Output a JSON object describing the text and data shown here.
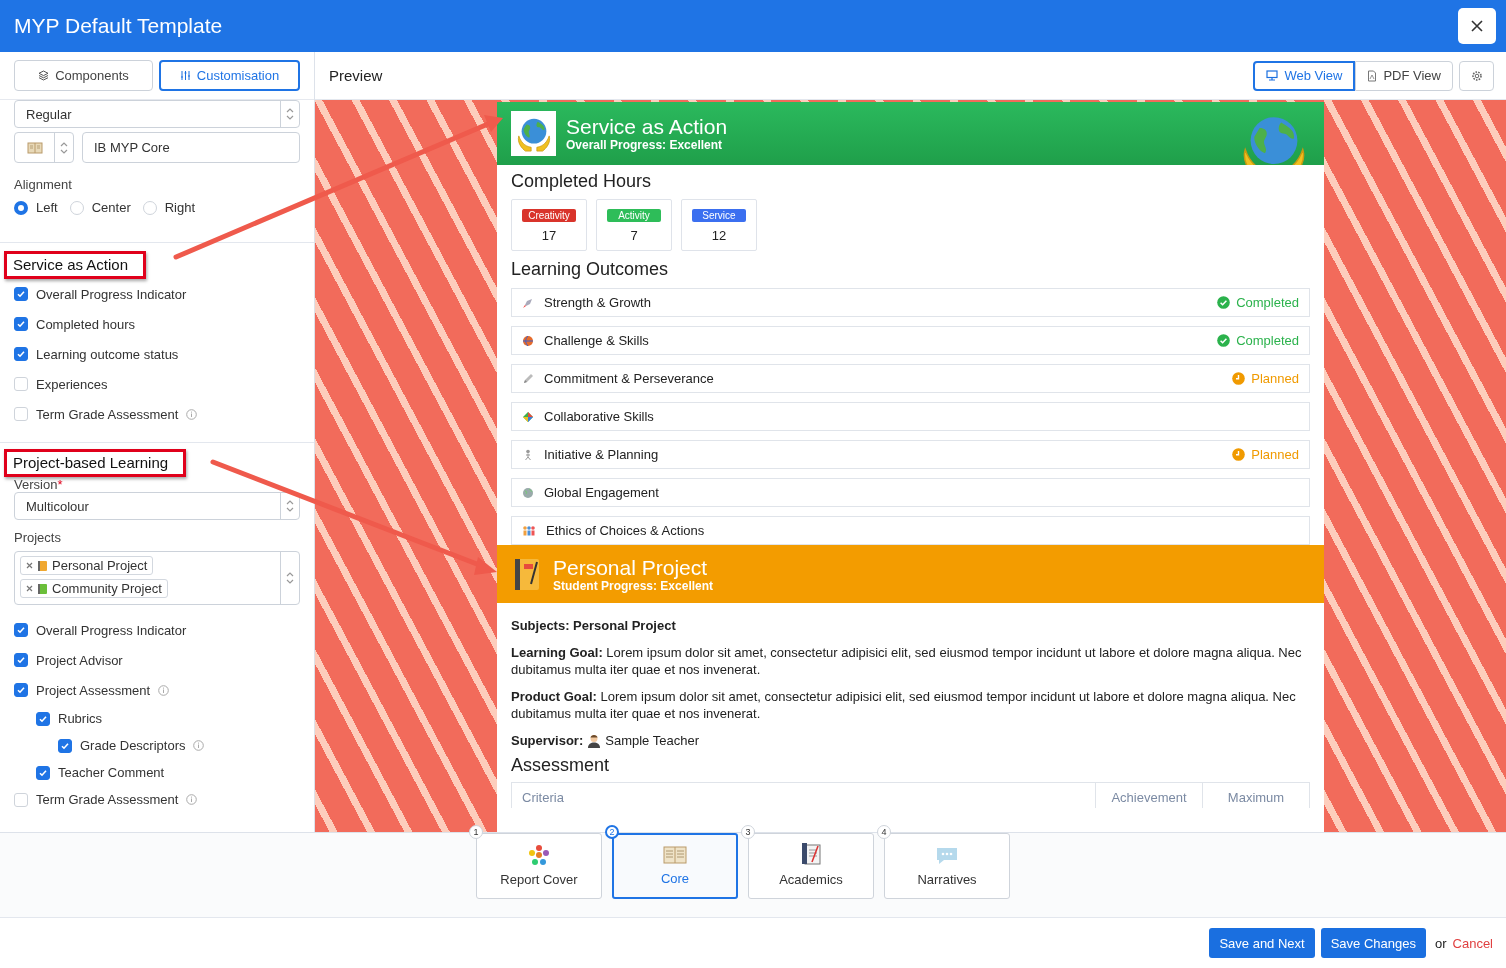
{
  "window": {
    "title": "MYP Default Template"
  },
  "sidebar": {
    "tabs": [
      {
        "label": "Components",
        "selected": false
      },
      {
        "label": "Customisation",
        "selected": true
      }
    ],
    "style_select": {
      "value": "Regular"
    },
    "title_field": {
      "value": "IB MYP Core"
    },
    "alignment": {
      "label": "Alignment",
      "options": [
        {
          "label": "Left",
          "selected": true
        },
        {
          "label": "Center",
          "selected": false
        },
        {
          "label": "Right",
          "selected": false
        }
      ]
    },
    "sections": [
      {
        "title": "Service as Action",
        "options": [
          {
            "label": "Overall Progress Indicator",
            "checked": true,
            "info": false
          },
          {
            "label": "Completed hours",
            "checked": true,
            "info": false
          },
          {
            "label": "Learning outcome status",
            "checked": true,
            "info": false
          },
          {
            "label": "Experiences",
            "checked": false,
            "info": false
          },
          {
            "label": "Term Grade Assessment",
            "checked": false,
            "info": true
          }
        ]
      },
      {
        "title": "Project-based Learning",
        "version": {
          "label": "Version",
          "required_mark": "*",
          "value": "Multicolour"
        },
        "projects": {
          "label": "Projects",
          "tags": [
            "Personal Project",
            "Community Project"
          ]
        },
        "options": [
          {
            "label": "Overall Progress Indicator",
            "checked": true,
            "info": false
          },
          {
            "label": "Project Advisor",
            "checked": true,
            "info": false
          },
          {
            "label": "Project Assessment",
            "checked": true,
            "info": true,
            "children": [
              {
                "label": "Rubrics",
                "checked": true,
                "info": false,
                "children": [
                  {
                    "label": "Grade Descriptors",
                    "checked": true,
                    "info": true
                  }
                ]
              },
              {
                "label": "Teacher Comment",
                "checked": true,
                "info": false
              }
            ]
          },
          {
            "label": "Term Grade Assessment",
            "checked": false,
            "info": true
          }
        ]
      }
    ]
  },
  "preview": {
    "title": "Preview",
    "view_tabs": [
      {
        "label": "Web View",
        "selected": true
      },
      {
        "label": "PDF View",
        "selected": false
      }
    ],
    "service": {
      "title": "Service as Action",
      "subtitle": "Overall Progress: Excellent",
      "hours_title": "Completed Hours",
      "hours": [
        {
          "label": "Creativity",
          "value": "17",
          "color": "#d9342b"
        },
        {
          "label": "Activity",
          "value": "7",
          "color": "#2ebd59"
        },
        {
          "label": "Service",
          "value": "12",
          "color": "#3b6ff0"
        }
      ],
      "outcomes_title": "Learning Outcomes",
      "outcomes": [
        {
          "label": "Strength & Growth",
          "kind": "completed",
          "status": "Completed"
        },
        {
          "label": "Challenge & Skills",
          "kind": "completed",
          "status": "Completed"
        },
        {
          "label": "Commitment & Perseverance",
          "kind": "planned",
          "status": "Planned"
        },
        {
          "label": "Collaborative Skills",
          "kind": "none"
        },
        {
          "label": "Initiative & Planning",
          "kind": "planned",
          "status": "Planned"
        },
        {
          "label": "Global Engagement",
          "kind": "none"
        },
        {
          "label": "Ethics of Choices & Actions",
          "kind": "none"
        }
      ]
    },
    "project": {
      "title": "Personal Project",
      "subtitle": "Student Progress: Excellent",
      "subjects": "Subjects: Personal Project",
      "goals": [
        {
          "label": "Learning Goal:",
          "text": "Lorem ipsum dolor sit amet, consectetur adipisici elit, sed eiusmod tempor incidunt ut labore et dolore magna aliqua. Nec dubitamus multa iter quae et nos invenerat."
        },
        {
          "label": "Product Goal:",
          "text": "Lorem ipsum dolor sit amet, consectetur adipisici elit, sed eiusmod tempor incidunt ut labore et dolore magna aliqua. Nec dubitamus multa iter quae et nos invenerat."
        }
      ],
      "supervisor": {
        "label": "Supervisor:",
        "name": "Sample Teacher"
      },
      "assessment_title": "Assessment",
      "columns": [
        "Criteria",
        "Achievement",
        "Maximum"
      ]
    }
  },
  "steps": [
    {
      "number": "1",
      "label": "Report Cover",
      "selected": false
    },
    {
      "number": "2",
      "label": "Core",
      "selected": true
    },
    {
      "number": "3",
      "label": "Academics",
      "selected": false
    },
    {
      "number": "4",
      "label": "Narratives",
      "selected": false
    }
  ],
  "footer": {
    "buttons": [
      "Save and Next",
      "Save Changes"
    ],
    "or": "or",
    "cancel": "Cancel"
  }
}
